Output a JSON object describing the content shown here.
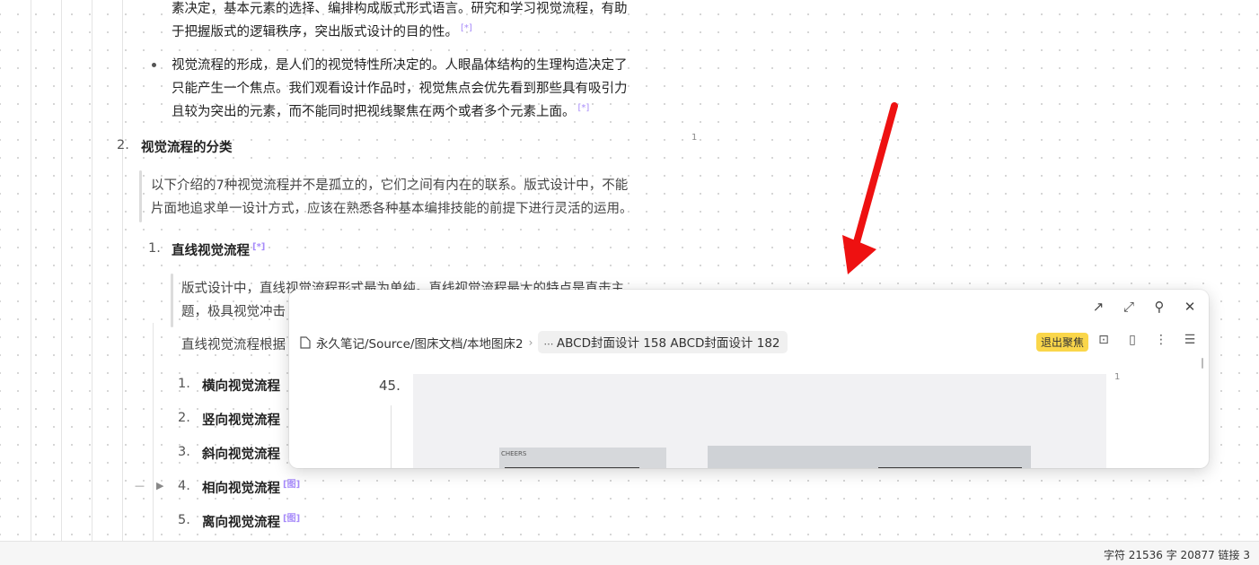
{
  "doc": {
    "para1_line1": "素决定，基本元素的选择、编排构成版式形式语言。研究和学习视觉流程，有助",
    "para1_line2": "于把握版式的逻辑秩序，突出版式设计的目的性。",
    "cite": "[*]",
    "bullet2_line1": "视觉流程的形成，是人们的视觉特性所决定的。人眼晶体结构的生理构造决定了",
    "bullet2_line2": "只能产生一个焦点。我们观看设计作品时，视觉焦点会优先看到那些具有吸引力",
    "bullet2_line3": "且较为突出的元素，而不能同时把视线聚焦在两个或者多个元素上面。",
    "section2_num": "2.",
    "section2_title": "视觉流程的分类",
    "ref_count": "1",
    "quote_line1": "以下介绍的7种视觉流程并不是孤立的，它们之间有内在的联系。版式设计中，不能",
    "quote_line2": "片面地追求单一设计方式，应该在熟悉各种基本编排技能的前提下进行灵活的运用。",
    "sub1_num": "1.",
    "sub1_title": "直线视觉流程",
    "sub1_quote_line1": "版式设计中，直线视觉流程形式最为单纯。直线视觉流程最大的特点是直击主",
    "sub1_quote_line2": "题，极具视觉冲击",
    "sub1_para": "直线视觉流程根据",
    "items": [
      {
        "num": "1.",
        "label": "横向视觉流程"
      },
      {
        "num": "2.",
        "label": "竖向视觉流程"
      },
      {
        "num": "3.",
        "label": "斜向视觉流程"
      },
      {
        "num": "4.",
        "label": "相向视觉流程",
        "cite": "[图]"
      },
      {
        "num": "5.",
        "label": "离向视觉流程",
        "cite": "[图]"
      }
    ],
    "fold_dash": "—",
    "fold_arrow": "▶"
  },
  "popover": {
    "header_icons": [
      "open-external-icon",
      "expand-icon",
      "pin-icon",
      "close-icon"
    ],
    "header_glyphs": [
      "↗",
      "⤢",
      "⚲",
      "✕"
    ],
    "breadcrumb_path": "永久笔记/Source/图床文档/本地图床2",
    "breadcrumb_sep": "›",
    "breadcrumb_current": "ABCD封面设计 158 ABCD封面设计 182",
    "exit_focus_label": "退出聚焦",
    "tool_icons": [
      "lock-icon",
      "page-icon",
      "more-icon",
      "outline-icon"
    ],
    "tool_glyphs": [
      "⊡",
      "▯",
      "⋮",
      "☰"
    ],
    "list_num": "45.",
    "badge": "1",
    "image_caption": "CHEERS"
  },
  "statusbar": {
    "text": "字符 21536  字 20877  链接 3"
  },
  "colors": {
    "accent_yellow": "#fad64a",
    "cite_purple": "#a78bfa",
    "arrow_red": "#ee1111"
  }
}
